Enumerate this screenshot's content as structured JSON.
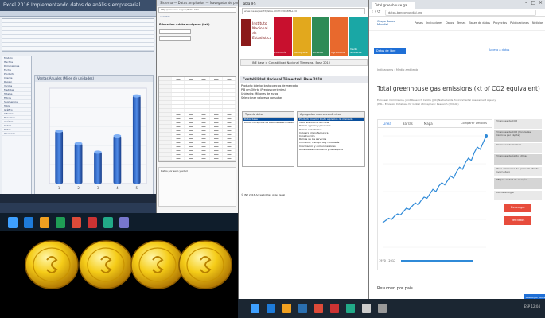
{
  "pane1": {
    "title": "Excel 2016 Implementando datos de análisis empresarial",
    "chart_header": "Ventas Anuales (Miles de unidades)",
    "tree_items": [
      "Modelo",
      "Hechos",
      "Dimensiones",
      "Fecha",
      "Producto",
      "Cliente",
      "Región",
      "Ventas",
      "Medidas",
      "Totales",
      "Filtros",
      "Segmentos",
      "Tabla",
      "Gráfico",
      "Informe",
      "Resumen",
      "Análisis",
      "Cubos",
      "Datos",
      "Opciones"
    ]
  },
  "chart_data": {
    "type": "bar",
    "categories": [
      "1",
      "2",
      "3",
      "4",
      "5"
    ],
    "values": [
      55,
      42,
      33,
      50,
      92
    ],
    "ylim": [
      0,
      100
    ],
    "grid": true
  },
  "pane2": {
    "tab": "Sistema — Datos ampliados — Navegador de pivotes",
    "url": "http://www.ine.es/jaxi/Tabla.htm",
    "brand": "eurostat",
    "title": "Education - data navigator (tab)",
    "lower_text": "Datos por sexo y edad"
  },
  "pane3": {
    "tab": "Tabla IFS",
    "url": "www.ine.es/jaxiT3/Tabla.htm?t=30685&L=0",
    "org_lines": [
      "Instituto",
      "Nacional de",
      "Estadística"
    ],
    "tiles": [
      {
        "label": "Economía",
        "color": "#c8102e"
      },
      {
        "label": "Demografía",
        "color": "#e2a81d"
      },
      {
        "label": "Sociedad",
        "color": "#2e8b57"
      },
      {
        "label": "Agricultura",
        "color": "#e8692d"
      },
      {
        "label": "Medio ambiente",
        "color": "#1aa7a5"
      }
    ],
    "nav": "INE base > Contabilidad Nacional Trimestral. Base 2010",
    "header": "Contabilidad Nacional Trimestral. Base 2010",
    "info_lines": [
      "Producto interior bruto precios de mercado",
      "PIB pm Oferta (Precios corrientes)",
      "Unidades: Millones de euros",
      "Seleccionar valores a consultar"
    ],
    "selector_left": {
      "title": "Tipo de dato",
      "items": [
        "Datos base",
        "Datos corregidos de efectos estacionales y de calendario"
      ]
    },
    "selector_right": {
      "title": "Agregados macroeconómicos",
      "items": [
        "Producto interior bruto a precios de mercado",
        "Valor añadido bruto total",
        "Ramas agraria y pesquera",
        "Ramas industriales",
        "Industria manufacturera",
        "Construcción",
        "Ramas de los servicios",
        "Comercio, transporte y hostelería",
        "Información y comunicaciones",
        "Actividades financieras y de seguros"
      ]
    },
    "footer": "© INE 2016   Accesibilidad   Aviso legal"
  },
  "pane4": {
    "tab": "Total greenhouse ga",
    "url": "datos.bancomundial.org",
    "logo": "Grupo Banco Mundial",
    "menu": [
      "Países",
      "Indicadores",
      "Datos",
      "Temas",
      "Bases de datos",
      "Proyectos",
      "Publicaciones",
      "Noticias",
      "Blogs"
    ],
    "blue_button": "Datos de libre acceso",
    "blue_link": "Acceso a datos",
    "crumb": "Indicadores › Medio ambiente",
    "title": "Total greenhouse gas emissions (kt of CO2 equivalent)",
    "meta": "European Commission, Joint Research Centre (JRC)/Netherlands Environmental Assessment Agency (PBL). Emission Database for Global Atmospheric Research (EDGAR)",
    "viz_tabs": [
      "Línea",
      "Barras",
      "Mapa"
    ],
    "viz_buttons": "Compartir   Detalles",
    "side_items": [
      "Emisiones de CO2",
      "Emisiones de CO2 (toneladas métricas per cápita)",
      "Emisiones de metano",
      "Emisiones de óxido nitroso",
      "Otras emisiones de gases de efecto invernadero",
      "PIB por unidad de energía",
      "Uso de energía"
    ],
    "red_buttons": [
      "Descargar",
      "Ver datos"
    ],
    "year": "1970 - 2012",
    "resumen": "Resumen por país",
    "download": "Descargar datos",
    "line_values": [
      22,
      24,
      26,
      25,
      28,
      30,
      29,
      32,
      35,
      34,
      37,
      40,
      38,
      42,
      45,
      44,
      48,
      52,
      50,
      55,
      58,
      56,
      60,
      64,
      62,
      68,
      72,
      70,
      76,
      80,
      78,
      85,
      90,
      88,
      94,
      100
    ]
  },
  "taskbar1": {
    "icons": [
      "#1e7bd9",
      "#f0a020",
      "#1f9d55",
      "#dd4b39",
      "#c33",
      "#2a8",
      "#77c"
    ]
  },
  "taskbar2": {
    "icons": [
      "#1e7bd9",
      "#f0a020",
      "#2a6fb0",
      "#dd4b39",
      "#c33",
      "#2a8",
      "#ccc",
      "#999"
    ],
    "tray": "ESP  12:04"
  }
}
